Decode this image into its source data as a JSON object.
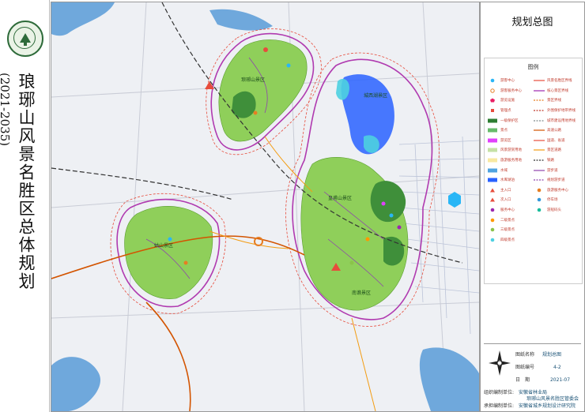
{
  "banner": {
    "title": "琅琊山风景名胜区总体规划",
    "years": "(2021-2035)"
  },
  "plan": {
    "title": "规划总图"
  },
  "legend": {
    "heading": "图例",
    "left": [
      {
        "label": "游客中心",
        "color": "#29b6f6",
        "shape": "circle"
      },
      {
        "label": "游客服务中心",
        "color": "#e67e22",
        "shape": "ring"
      },
      {
        "label": "游览设施",
        "color": "#e91e63",
        "shape": "pentagon"
      },
      {
        "label": "管理点",
        "color": "#e74c3c",
        "shape": "square"
      },
      {
        "label": "一级保护区",
        "color": "#2e7d32",
        "shape": "rect"
      },
      {
        "label": "景点",
        "color": "#66bb6a",
        "shape": "rect"
      },
      {
        "label": "游览区",
        "color": "#e040fb",
        "shape": "rect"
      },
      {
        "label": "风景游赏用地",
        "color": "#c5e1a5",
        "shape": "rect"
      },
      {
        "label": "旅游服务用地",
        "color": "#f8e9a1",
        "shape": "rect"
      },
      {
        "label": "水域",
        "color": "#4fa3e0",
        "shape": "rect"
      },
      {
        "label": "水库湖泊",
        "color": "#2962ff",
        "shape": "rect"
      },
      {
        "label": "主入口",
        "color": "#e74c3c",
        "shape": "triangle"
      },
      {
        "label": "次入口",
        "color": "#e74c3c",
        "shape": "triangle"
      },
      {
        "label": "服务中心",
        "color": "#9c27b0",
        "shape": "circle"
      },
      {
        "label": "二级景点",
        "color": "#ff9800",
        "shape": "circle"
      },
      {
        "label": "三级景点",
        "color": "#8bc34a",
        "shape": "circle"
      },
      {
        "label": "四级景点",
        "color": "#4dd0e1",
        "shape": "circle"
      }
    ],
    "right": [
      {
        "label": "风景名胜区界线",
        "color": "#e74c3c",
        "shape": "line"
      },
      {
        "label": "核心景区界线",
        "color": "#9c27b0",
        "shape": "line"
      },
      {
        "label": "景区界线",
        "color": "#e67e22",
        "shape": "dash"
      },
      {
        "label": "外围保护地带界线",
        "color": "#c0392b",
        "shape": "dash"
      },
      {
        "label": "城市建设用地界线",
        "color": "#7f8c8d",
        "shape": "dash"
      },
      {
        "label": "高速公路",
        "color": "#d35400",
        "shape": "line"
      },
      {
        "label": "国道、省道",
        "color": "#e74c3c",
        "shape": "line"
      },
      {
        "label": "景区道路",
        "color": "#f39c12",
        "shape": "line"
      },
      {
        "label": "铁路",
        "color": "#333333",
        "shape": "dash"
      },
      {
        "label": "游步道",
        "color": "#8e44ad",
        "shape": "line"
      },
      {
        "label": "规划游步道",
        "color": "#8e44ad",
        "shape": "dash"
      },
      {
        "label": "旅游服务中心",
        "color": "#e67e22",
        "shape": "circle"
      },
      {
        "label": "停车场",
        "color": "#3498db",
        "shape": "circle"
      },
      {
        "label": "游船码头",
        "color": "#1abc9c",
        "shape": "circle"
      }
    ]
  },
  "titleblock": {
    "drawing_name_label": "图纸名称",
    "drawing_name": "规划总图",
    "drawing_no_label": "图纸编号",
    "drawing_no": "4-2",
    "date_label": "日　期",
    "date": "2021-07",
    "org_label": "组织编制单位:",
    "org_1": "安徽省林业局",
    "org_2": "琅琊山风景名胜区管委会",
    "author_label": "承担编制单位:",
    "author": "安徽省城乡规划设计研究院"
  },
  "map": {
    "zone_labels": [
      "琅琊山景区",
      "城西湖景区",
      "姑山景区",
      "皇甫山景区",
      "南谯景区"
    ]
  }
}
